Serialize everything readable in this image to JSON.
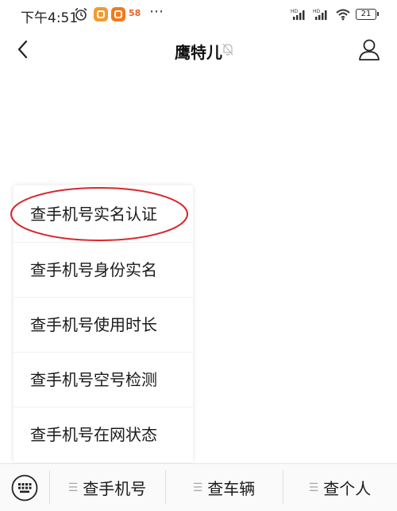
{
  "status_bar": {
    "time": "下午4:51",
    "app_58": "58",
    "more": "⋯",
    "battery": "21"
  },
  "header": {
    "title": "鹰特儿"
  },
  "menu": {
    "items": [
      {
        "label": "查手机号实名认证"
      },
      {
        "label": "查手机号身份实名"
      },
      {
        "label": "查手机号使用时长"
      },
      {
        "label": "查手机号空号检测"
      },
      {
        "label": "查手机号在网状态"
      }
    ],
    "highlight_color": "#d9262c"
  },
  "bottom_bar": {
    "tabs": [
      {
        "label": "查手机号"
      },
      {
        "label": "查车辆"
      },
      {
        "label": "查个人"
      }
    ]
  }
}
